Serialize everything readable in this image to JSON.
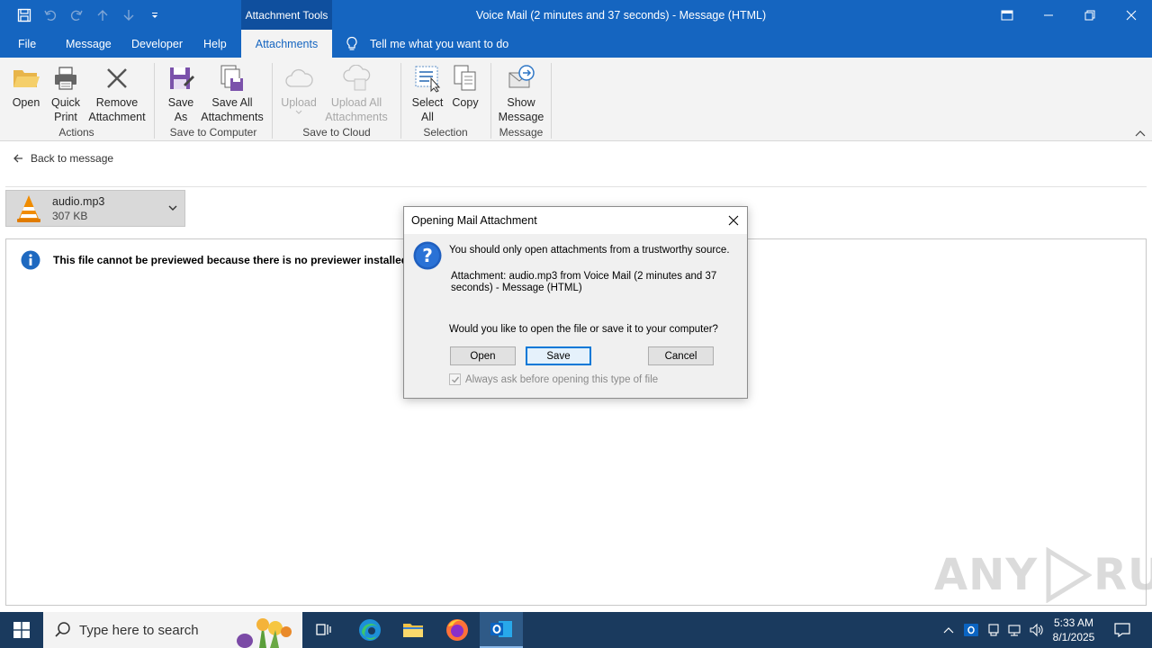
{
  "titlebar": {
    "context_tab_label": "Attachment Tools",
    "window_title": "Voice Mail (2 minutes and 37 seconds)  -  Message (HTML)"
  },
  "tabs": {
    "file": "File",
    "message": "Message",
    "developer": "Developer",
    "help": "Help",
    "attachments": "Attachments",
    "tell_me": "Tell me what you want to do"
  },
  "ribbon": {
    "open": "Open",
    "quick_print_1": "Quick",
    "quick_print_2": "Print",
    "remove_1": "Remove",
    "remove_2": "Attachment",
    "group_actions": "Actions",
    "save_as_1": "Save",
    "save_as_2": "As",
    "save_all_1": "Save All",
    "save_all_2": "Attachments",
    "group_save_computer": "Save to Computer",
    "upload": "Upload",
    "upload_all_1": "Upload All",
    "upload_all_2": "Attachments",
    "group_save_cloud": "Save to Cloud",
    "select_all_1": "Select",
    "select_all_2": "All",
    "copy": "Copy",
    "group_selection": "Selection",
    "show_message_1": "Show",
    "show_message_2": "Message",
    "group_message": "Message"
  },
  "content": {
    "back_link": "Back to message",
    "attachment_name": "audio.mp3",
    "attachment_size": "307 KB",
    "preview_notice": "This file cannot be previewed because there is no previewer installed for it."
  },
  "dialog": {
    "title": "Opening Mail Attachment",
    "warning": "You should only open attachments from a trustworthy source.",
    "attachment_line1": "Attachment: audio.mp3 from Voice Mail (2 minutes and 37",
    "attachment_line2": "seconds) - Message (HTML)",
    "question": "Would you like to open the file or save it to your computer?",
    "open_btn": "Open",
    "save_btn": "Save",
    "cancel_btn": "Cancel",
    "always_ask": "Always ask before opening this type of file",
    "always_ask_checked": true
  },
  "watermark": {
    "left": "ANY",
    "right": "RUN"
  },
  "taskbar": {
    "search_placeholder": "Type here to search",
    "time": "5:33 AM",
    "date": "8/1/2025"
  },
  "colors": {
    "title_bar": "#1565c0",
    "ribbon_bg": "#f3f3f3",
    "taskbar": "#1a3a5e",
    "dialog_default_border": "#0078d7"
  }
}
